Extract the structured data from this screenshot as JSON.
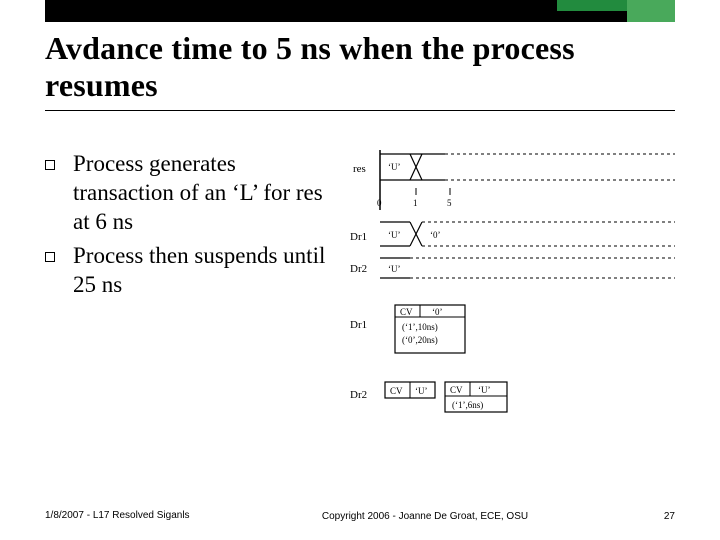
{
  "title": "Avdance time to 5 ns when the process resumes",
  "bullets": [
    "Process generates transaction of an ‘L’ for res at 6 ns",
    "Process then suspends until 25 ns"
  ],
  "diagram": {
    "rowLabels": {
      "res": "res",
      "dr1": "Dr1",
      "dr2": "Dr2",
      "Dr1": "Dr1",
      "Dr2": "Dr2"
    },
    "values": {
      "resVal": "‘U’",
      "dr1a": "‘U’",
      "dr1b": "‘0’",
      "dr2a": "‘U’"
    },
    "ticks": {
      "t0": "0",
      "t1": "1",
      "t5": "5"
    },
    "boxes": {
      "box1": [
        "CV",
        "‘0’",
        "(‘1’,10ns)",
        "(‘0’,20ns)"
      ],
      "box2a": [
        "CV",
        "‘U’"
      ],
      "box2b": [
        "CV",
        "‘U’",
        "(‘1’,6ns)"
      ]
    }
  },
  "footer": {
    "left": "1/8/2007 - L17 Resolved Siganls",
    "center": "Copyright 2006 - Joanne De Groat, ECE, OSU",
    "right": "27"
  }
}
